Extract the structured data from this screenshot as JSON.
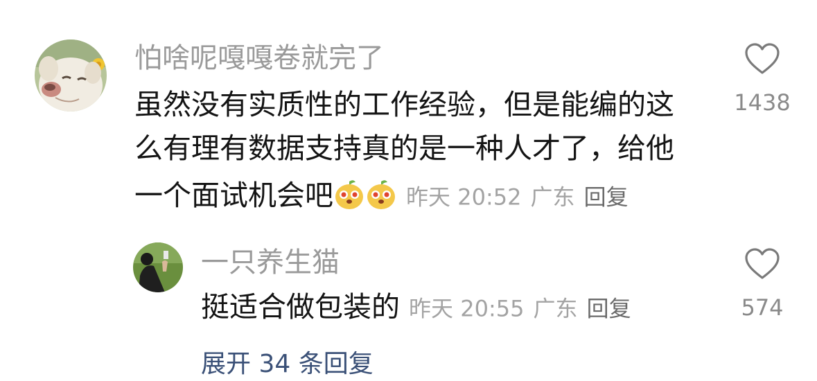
{
  "comment": {
    "username": "怕啥呢嘎嘎卷就完了",
    "text_line1": "虽然没有实质性的工作经验，但是能编的这",
    "text_line2": "么有理有数据支持真的是一种人才了，给他",
    "text_line3": "一个面试机会吧",
    "time": "昨天 20:52",
    "location": "广东",
    "reply_label": "回复",
    "like_count": "1438"
  },
  "reply": {
    "username": "一只养生猫",
    "text": "挺适合做包装的",
    "time": "昨天 20:55",
    "location": "广东",
    "reply_label": "回复",
    "like_count": "574"
  },
  "expand_label": "展开 34 条回复"
}
